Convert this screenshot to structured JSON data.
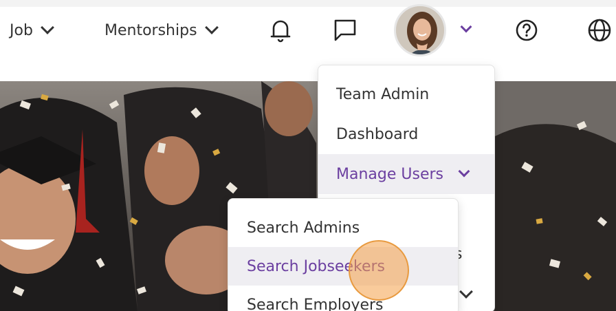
{
  "nav": {
    "job_label": "Job",
    "mentorships_label": "Mentorships",
    "icons": [
      "bell-icon",
      "chat-icon",
      "user-avatar",
      "chevron-down-icon",
      "help-icon",
      "globe-icon"
    ]
  },
  "user_menu": {
    "items": [
      {
        "label": "Team Admin"
      },
      {
        "label": "Dashboard"
      },
      {
        "label": "Manage Users"
      }
    ],
    "partial_text": "s"
  },
  "manage_users_submenu": {
    "items": [
      {
        "label": "Search Admins"
      },
      {
        "label": "Search Jobseekers"
      },
      {
        "label": "Search Employers"
      }
    ]
  },
  "colors": {
    "accent": "#6b3fa0",
    "text": "#333333",
    "highlight_bg": "#efeef2",
    "cursor": "#f4a048"
  }
}
